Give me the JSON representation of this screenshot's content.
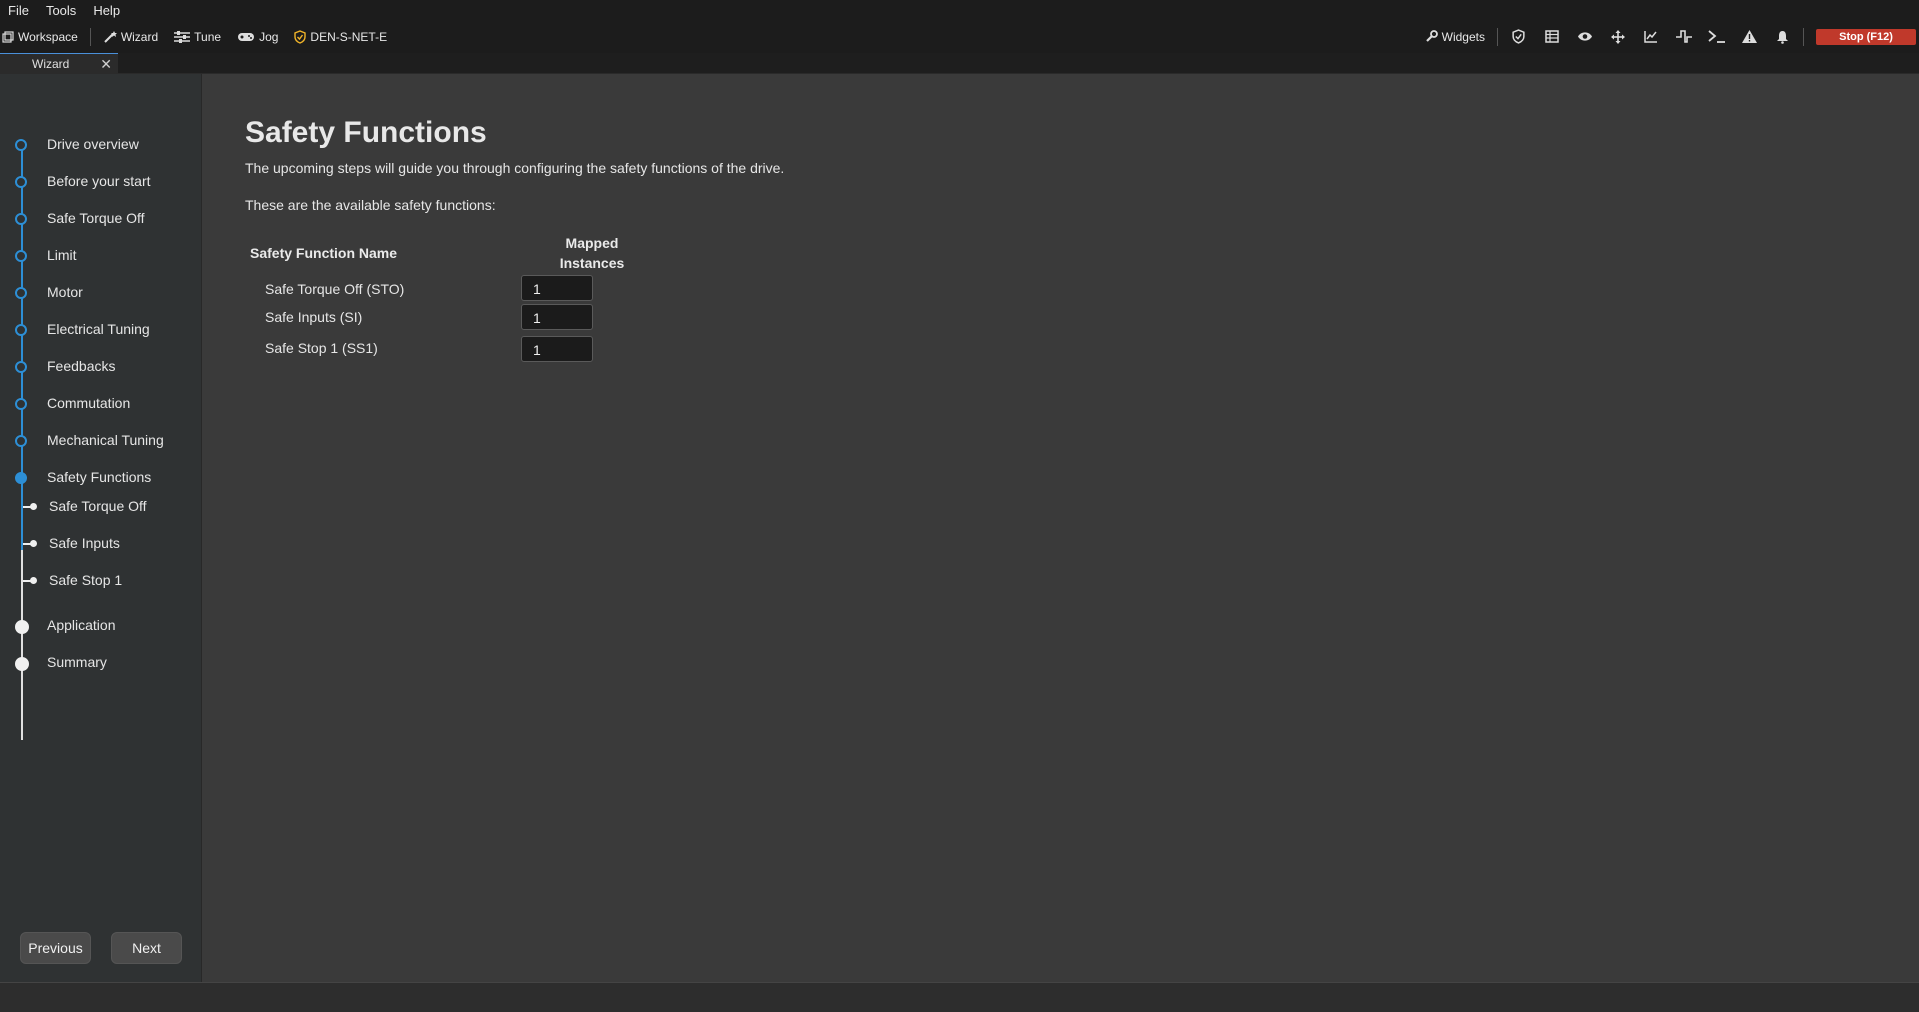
{
  "menubar": {
    "items": [
      "File",
      "Tools",
      "Help"
    ]
  },
  "toolbar": {
    "workspace": "Workspace",
    "wizard": "Wizard",
    "tune": "Tune",
    "jog": "Jog",
    "device": "DEN-S-NET-E",
    "widgets": "Widgets",
    "stop": "Stop (F12)",
    "icons": [
      "shield-check-icon",
      "table-icon",
      "eye-icon",
      "move-icon",
      "chart-icon",
      "signal-icon",
      "terminal-icon",
      "warning-icon",
      "bell-icon"
    ]
  },
  "tab": {
    "label": "Wizard",
    "close": "✕"
  },
  "steps": [
    {
      "label": "Drive overview"
    },
    {
      "label": "Before your start"
    },
    {
      "label": "Safe Torque Off"
    },
    {
      "label": "Limit"
    },
    {
      "label": "Motor"
    },
    {
      "label": "Electrical Tuning"
    },
    {
      "label": "Feedbacks"
    },
    {
      "label": "Commutation"
    },
    {
      "label": "Mechanical Tuning"
    },
    {
      "label": "Safety Functions"
    }
  ],
  "substeps": [
    {
      "label": "Safe Torque Off"
    },
    {
      "label": "Safe Inputs"
    },
    {
      "label": "Safe Stop 1"
    }
  ],
  "later_steps": [
    {
      "label": "Application"
    },
    {
      "label": "Summary"
    }
  ],
  "nav": {
    "previous": "Previous",
    "next": "Next"
  },
  "content": {
    "title": "Safety Functions",
    "intro": "The upcoming steps will guide you through configuring the safety functions of the drive.",
    "available": "These are the available safety functions:",
    "table": {
      "col_name": "Safety Function Name",
      "col_instances_1": "Mapped",
      "col_instances_2": "Instances",
      "rows": [
        {
          "name": "Safe Torque Off (STO)",
          "value": "1"
        },
        {
          "name": "Safe Inputs (SI)",
          "value": "1"
        },
        {
          "name": "Safe Stop 1 (SS1)",
          "value": "1"
        }
      ]
    }
  },
  "colors": {
    "accent": "#2d8fd6",
    "stop": "#c0392b"
  }
}
